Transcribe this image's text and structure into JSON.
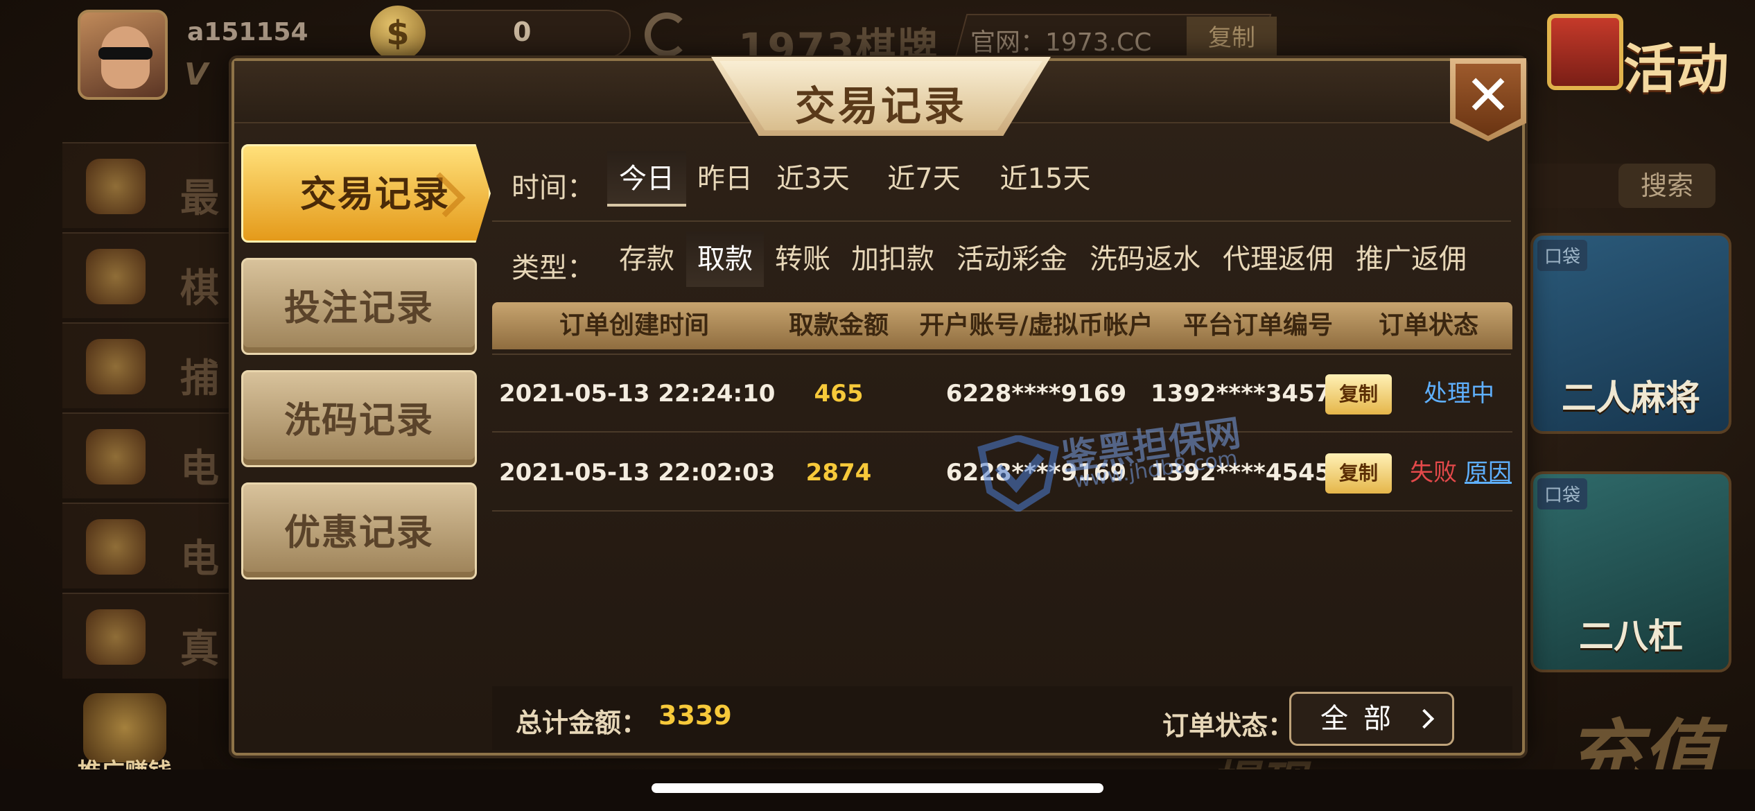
{
  "background": {
    "username": "a151154",
    "coin_symbol": "$",
    "coin_balance": "0",
    "brand": "1973棋牌",
    "official_site": "官网：1973.CC",
    "copy_label": "复制",
    "activity_label": "活动",
    "search_label": "搜索",
    "left_menu": [
      "最",
      "棋",
      "捕",
      "电",
      "电",
      "真"
    ],
    "promo_label": "推广赚钱",
    "game_cards": [
      {
        "tag": "口袋",
        "title": "二人麻将"
      },
      {
        "tag": "口袋",
        "title": "二八杠"
      }
    ],
    "recharge_label": "充值",
    "withdraw_label": "提现"
  },
  "modal": {
    "title": "交易记录",
    "close_icon": "✕",
    "side_tabs": [
      "交易记录",
      "投注记录",
      "洗码记录",
      "优惠记录"
    ],
    "time_label": "时间：",
    "time_filters": [
      "今日",
      "昨日",
      "近3天",
      "近7天",
      "近15天"
    ],
    "type_label": "类型：",
    "type_filters": [
      "存款",
      "取款",
      "转账",
      "加扣款",
      "活动彩金",
      "洗码返水",
      "代理返佣",
      "推广返佣"
    ],
    "columns": [
      "订单创建时间",
      "取款金额",
      "开户账号/虚拟币帐户",
      "平台订单编号",
      "订单状态"
    ],
    "rows": [
      {
        "time": "2021-05-13 22:24:10",
        "amount": "465",
        "account": "6228****9169",
        "order": "1392****3457",
        "copy": "复制",
        "status": "处理中",
        "reason": ""
      },
      {
        "time": "2021-05-13 22:02:03",
        "amount": "2874",
        "account": "6228****9169",
        "order": "1392****4545",
        "copy": "复制",
        "status": "失败",
        "reason": "原因"
      }
    ],
    "total_label": "总计金额：",
    "total_value": "3339",
    "status_filter_label": "订单状态：",
    "status_filter_value": "全部"
  },
  "watermark": {
    "line1": "鉴黑担保网",
    "line2": "www.jhdb8.com"
  },
  "colors": {
    "accent_gold": "#f7c93a",
    "processing": "#5fb0ff",
    "failed": "#e4494a"
  }
}
